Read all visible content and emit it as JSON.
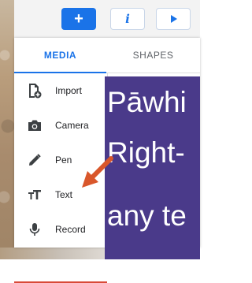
{
  "toolbar": {
    "add_label": "+",
    "info_label": "i"
  },
  "tabs": [
    {
      "label": "MEDIA",
      "active": true
    },
    {
      "label": "SHAPES",
      "active": false
    }
  ],
  "menu": [
    {
      "label": "Import",
      "icon": "import-icon"
    },
    {
      "label": "Camera",
      "icon": "camera-icon"
    },
    {
      "label": "Pen",
      "icon": "pen-icon"
    },
    {
      "label": "Text",
      "icon": "text-icon"
    },
    {
      "label": "Record",
      "icon": "microphone-icon"
    }
  ],
  "slide": {
    "lines": [
      "Pāwhi",
      "Right-",
      "any te"
    ]
  },
  "colors": {
    "accent": "#1a73e8",
    "slide_bg": "#4a3a8a",
    "arrow": "#d9572b"
  }
}
